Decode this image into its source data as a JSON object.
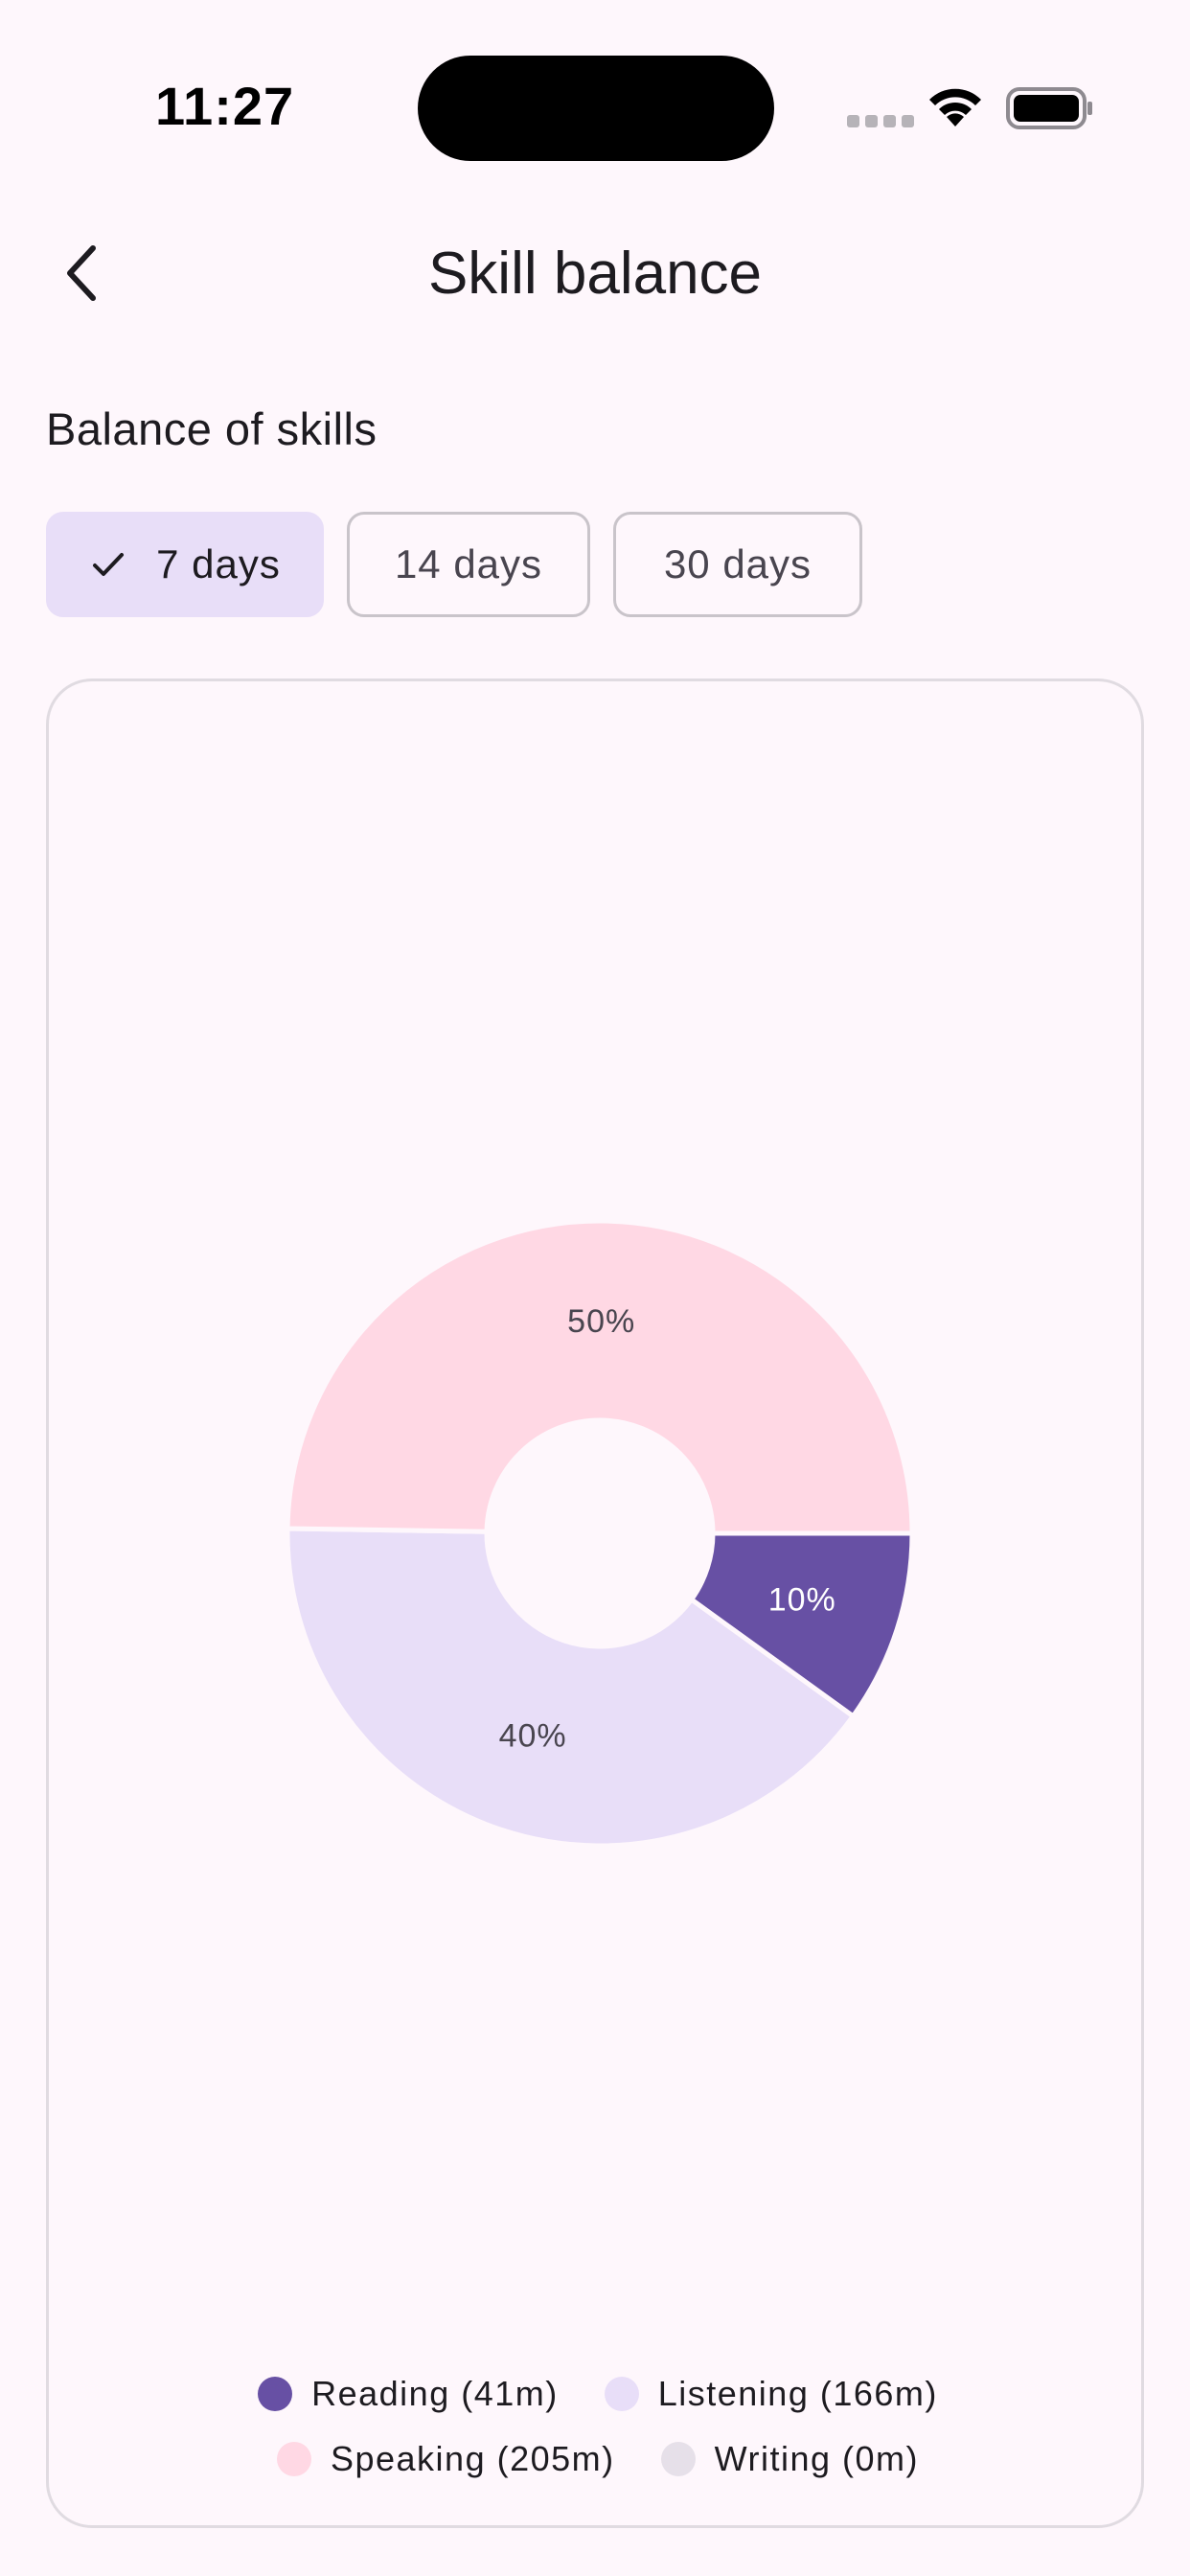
{
  "status_bar": {
    "time": "11:27"
  },
  "header": {
    "title": "Skill balance",
    "back_icon": "chevron-left-icon"
  },
  "section": {
    "title": "Balance of skills"
  },
  "filters": [
    {
      "label": "7 days",
      "selected": true
    },
    {
      "label": "14 days",
      "selected": false
    },
    {
      "label": "30 days",
      "selected": false
    }
  ],
  "colors": {
    "background": "#fef7fc",
    "reading": "#6750a4",
    "listening": "#e8def8",
    "speaking": "#ffd8e4",
    "writing": "#e6e0e9"
  },
  "chart_data": {
    "type": "pie",
    "donut": true,
    "categories": [
      "Reading",
      "Listening",
      "Speaking",
      "Writing"
    ],
    "values": [
      41,
      166,
      205,
      0
    ],
    "unit": "m",
    "slice_labels": [
      "10%",
      "40%",
      "50%",
      ""
    ],
    "legend": [
      "Reading (41m)",
      "Listening (166m)",
      "Speaking (205m)",
      "Writing (0m)"
    ],
    "legend_placement": "bottom"
  }
}
